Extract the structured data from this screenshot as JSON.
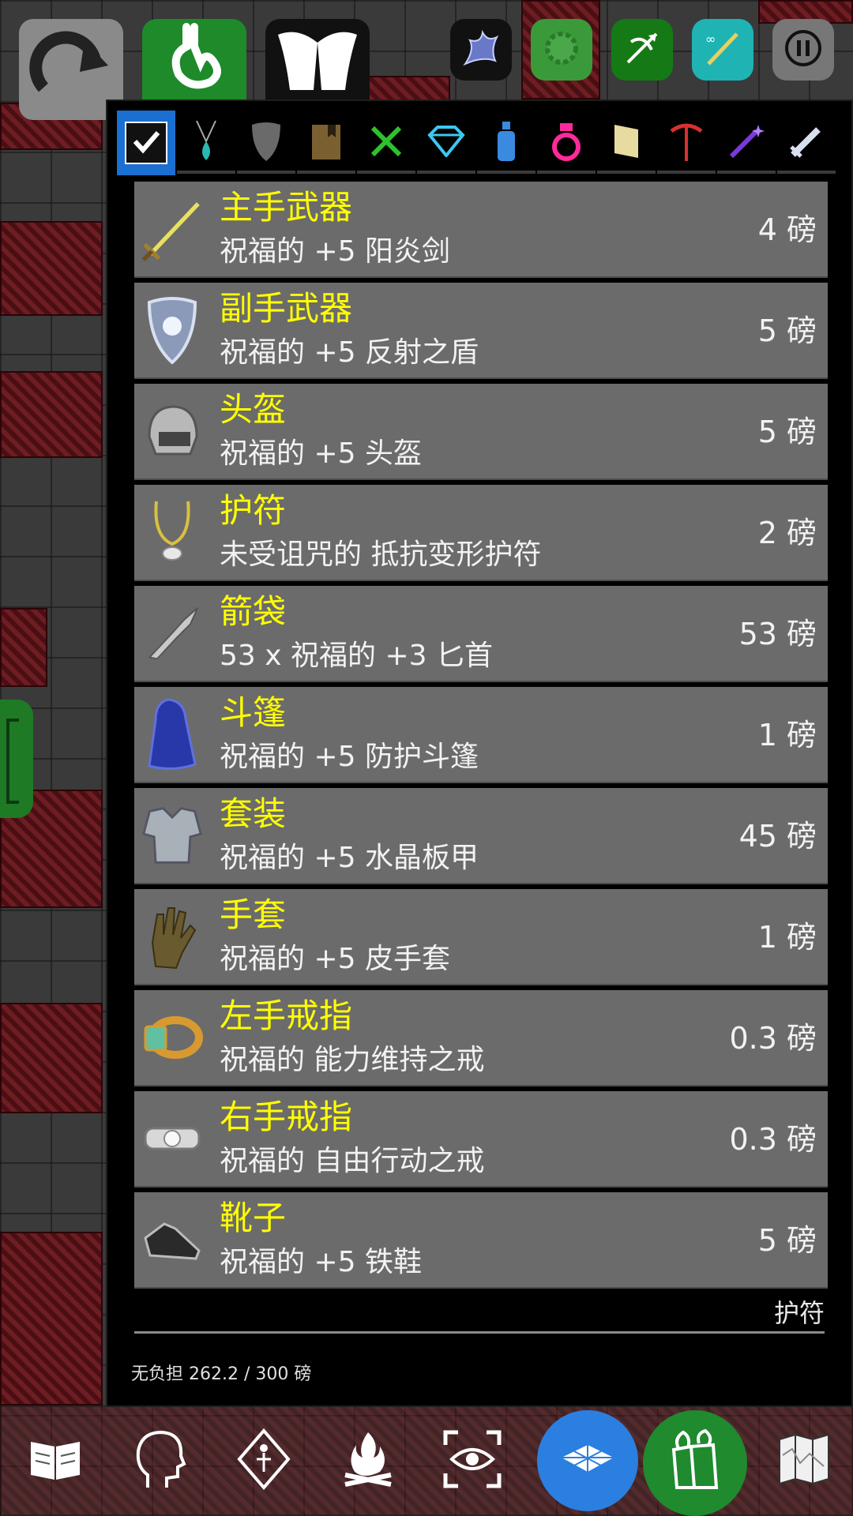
{
  "colors": {
    "slot_text": "#ffff00",
    "item_text": "#f2f2f2",
    "row_bg": "#6b6b6b",
    "active_tab": "#1a6fd0",
    "minimap_button": "#2b7fe0",
    "inventory_button": "#1f8a2e"
  },
  "top_bar": {
    "buttons": [
      {
        "icon": "redo-arrow-icon"
      },
      {
        "icon": "stomach-icon"
      },
      {
        "icon": "angel-wings-icon"
      },
      {
        "icon": "dragon-icon"
      },
      {
        "icon": "splat-icon"
      },
      {
        "icon": "bow-arrow-icon"
      },
      {
        "icon": "sword-infinity-icon"
      },
      {
        "icon": "pause-icon"
      }
    ]
  },
  "tabs": [
    {
      "icon": "checkbox-icon",
      "active": true
    },
    {
      "icon": "amulet-icon"
    },
    {
      "icon": "shield-icon"
    },
    {
      "icon": "book-icon"
    },
    {
      "icon": "fork-knife-icon"
    },
    {
      "icon": "gem-icon"
    },
    {
      "icon": "potion-icon"
    },
    {
      "icon": "ring-icon"
    },
    {
      "icon": "scroll-icon"
    },
    {
      "icon": "pickaxe-icon"
    },
    {
      "icon": "wand-icon"
    },
    {
      "icon": "sword-icon"
    }
  ],
  "equipment": [
    {
      "slot": "主手武器",
      "item": "祝福的 +5 阳炎剑",
      "weight": "4 磅",
      "icon": "sword-icon"
    },
    {
      "slot": "副手武器",
      "item": "祝福的 +5 反射之盾",
      "weight": "5 磅",
      "icon": "shield-icon"
    },
    {
      "slot": "头盔",
      "item": "祝福的 +5 头盔",
      "weight": "5 磅",
      "icon": "helmet-icon"
    },
    {
      "slot": "护符",
      "item": "未受诅咒的 抵抗变形护符",
      "weight": "2 磅",
      "icon": "amulet-icon"
    },
    {
      "slot": "箭袋",
      "item": "53 x 祝福的 +3 匕首",
      "weight": "53 磅",
      "icon": "dagger-icon"
    },
    {
      "slot": "斗篷",
      "item": "祝福的 +5 防护斗篷",
      "weight": "1 磅",
      "icon": "cloak-icon"
    },
    {
      "slot": "套装",
      "item": "祝福的 +5 水晶板甲",
      "weight": "45 磅",
      "icon": "armor-icon"
    },
    {
      "slot": "手套",
      "item": "祝福的 +5 皮手套",
      "weight": "1 磅",
      "icon": "glove-icon"
    },
    {
      "slot": "左手戒指",
      "item": "祝福的 能力维持之戒",
      "weight": "0.3 磅",
      "icon": "gold-ring-icon"
    },
    {
      "slot": "右手戒指",
      "item": "祝福的 自由行动之戒",
      "weight": "0.3 磅",
      "icon": "silver-ring-icon"
    },
    {
      "slot": "靴子",
      "item": "祝福的 +5 铁鞋",
      "weight": "5 磅",
      "icon": "boot-icon"
    }
  ],
  "footer": {
    "selected_label": "护符",
    "burden": "无负担 262.2 / 300 磅"
  },
  "bottom_bar": [
    {
      "icon": "spellbook-icon"
    },
    {
      "icon": "head-outline-icon"
    },
    {
      "icon": "rune-diamond-icon"
    },
    {
      "icon": "campfire-icon"
    },
    {
      "icon": "look-eye-icon"
    },
    {
      "icon": "minimap-icon"
    },
    {
      "icon": "inventory-bag-icon"
    },
    {
      "icon": "map-icon"
    }
  ]
}
